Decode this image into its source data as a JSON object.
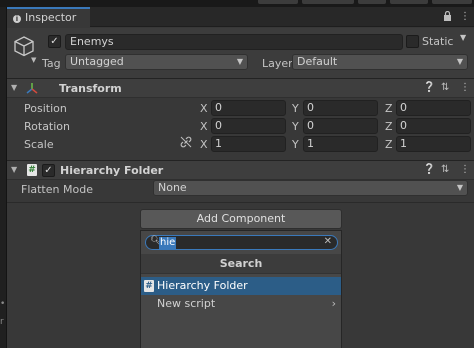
{
  "inspector": {
    "tab_label": "Inspector",
    "lock_icon": "lock-icon",
    "menu_icon": "kebab-menu-icon"
  },
  "gameobject": {
    "active": true,
    "name": "Enemys",
    "static_label": "Static",
    "static_checked": false,
    "tag_label": "Tag",
    "tag_value": "Untagged",
    "layer_label": "Layer",
    "layer_value": "Default"
  },
  "transform": {
    "title": "Transform",
    "rows": [
      {
        "label": "Position",
        "x": "0",
        "y": "0",
        "z": "0"
      },
      {
        "label": "Rotation",
        "x": "0",
        "y": "0",
        "z": "0"
      },
      {
        "label": "Scale",
        "x": "1",
        "y": "1",
        "z": "1"
      }
    ],
    "axis_labels": {
      "x": "X",
      "y": "Y",
      "z": "Z"
    }
  },
  "hierarchy_folder": {
    "title": "Hierarchy Folder",
    "enabled": true,
    "flatten_label": "Flatten Mode",
    "flatten_value": "None"
  },
  "add_component": {
    "button_label": "Add Component",
    "search_value": "hie",
    "popup_title": "Search",
    "items": [
      {
        "label": "Hierarchy Folder",
        "selected": true
      },
      {
        "label": "New script",
        "selected": false
      }
    ]
  },
  "colors": {
    "accent": "#3a79bb",
    "selection": "#2c5d87",
    "panel": "#383838"
  }
}
